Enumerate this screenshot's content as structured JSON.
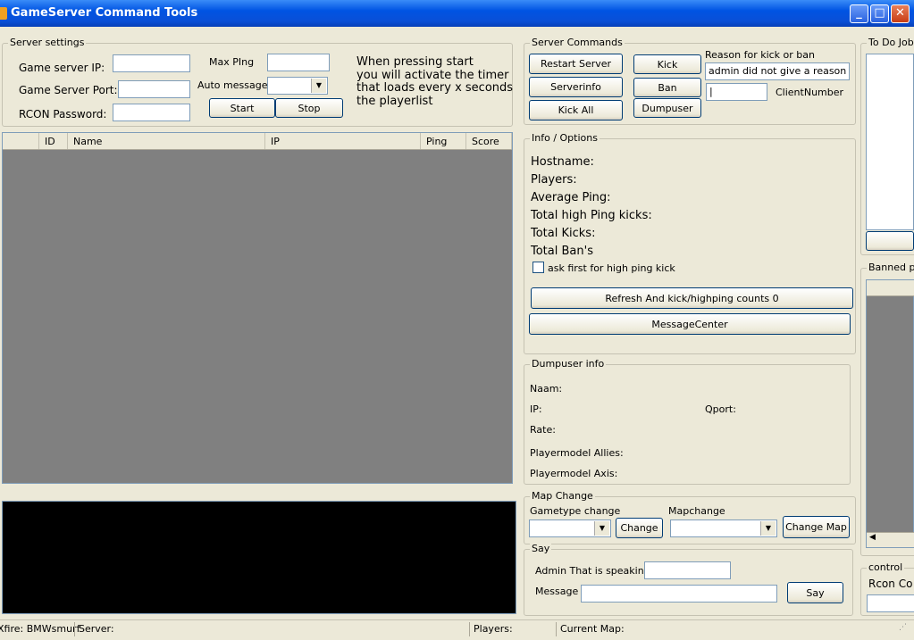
{
  "window": {
    "title": "GameServer Command Tools",
    "minimize": "_",
    "maximize": "□",
    "close": "✕"
  },
  "server_settings": {
    "group_label": "Server settings",
    "ip_label": "Game server IP:",
    "port_label": "Game Server Port:",
    "rcon_label": "RCON Password:",
    "maxping_label": "Max PIng",
    "automsg_label": "Auto message",
    "start_label": "Start",
    "stop_label": "Stop",
    "note_line1": "When pressing start",
    "note_line2": "you will activate the timer",
    "note_line3": " that loads every x seconds",
    "note_line4": " the playerlist",
    "ip_value": "",
    "port_value": "",
    "rcon_value": "",
    "maxping_value": ""
  },
  "player_list": {
    "columns": [
      "",
      "ID",
      "Name",
      "IP",
      "Ping",
      "Score"
    ]
  },
  "server_commands": {
    "group_label": "Server Commands",
    "restart": "Restart Server",
    "serverinfo": "Serverinfo",
    "kickall": "Kick All",
    "kick": "Kick",
    "ban": "Ban",
    "dumpuser": "Dumpuser",
    "reason_label": "Reason for kick or ban",
    "reason_value": "admin did not give a reason",
    "clientnumber_label": "ClientNumber",
    "clientnumber_value": "|"
  },
  "info_options": {
    "group_label": "Info /  Options",
    "hostname": "Hostname:",
    "players": "Players:",
    "avg_ping": "Average Ping:",
    "high_ping_kicks": "Total high Ping kicks:",
    "total_kicks": "Total Kicks:",
    "total_bans": "Total Ban's",
    "ask_first": "ask first for high ping kick",
    "refresh_button": "Refresh And kick/highping counts  0",
    "messagecenter_button": "MessageCenter"
  },
  "dumpuser_info": {
    "group_label": "Dumpuser info",
    "naam": "Naam:",
    "ip": "IP:",
    "qport": "Qport:",
    "rate": "Rate:",
    "model_allies": "Playermodel Allies:",
    "model_axis": "Playermodel Axis:"
  },
  "map_change": {
    "group_label": "Map Change",
    "gametype_label": "Gametype change",
    "change_button": "Change",
    "mapchange_label": "Mapchange",
    "changemap_button": "Change Map"
  },
  "say": {
    "group_label": "Say",
    "admin_label": "Admin That is speaking",
    "message_label": "Message",
    "say_button": "Say"
  },
  "right_panel": {
    "todo_label": "To Do Job",
    "banned_label": "Banned pl",
    "control_label": "control",
    "rcon_label": "Rcon Co"
  },
  "status_bar": {
    "xfire": "Xfire: BMWsmurf",
    "server": "Server:",
    "players": "Players:",
    "current_map": "Current Map:"
  }
}
